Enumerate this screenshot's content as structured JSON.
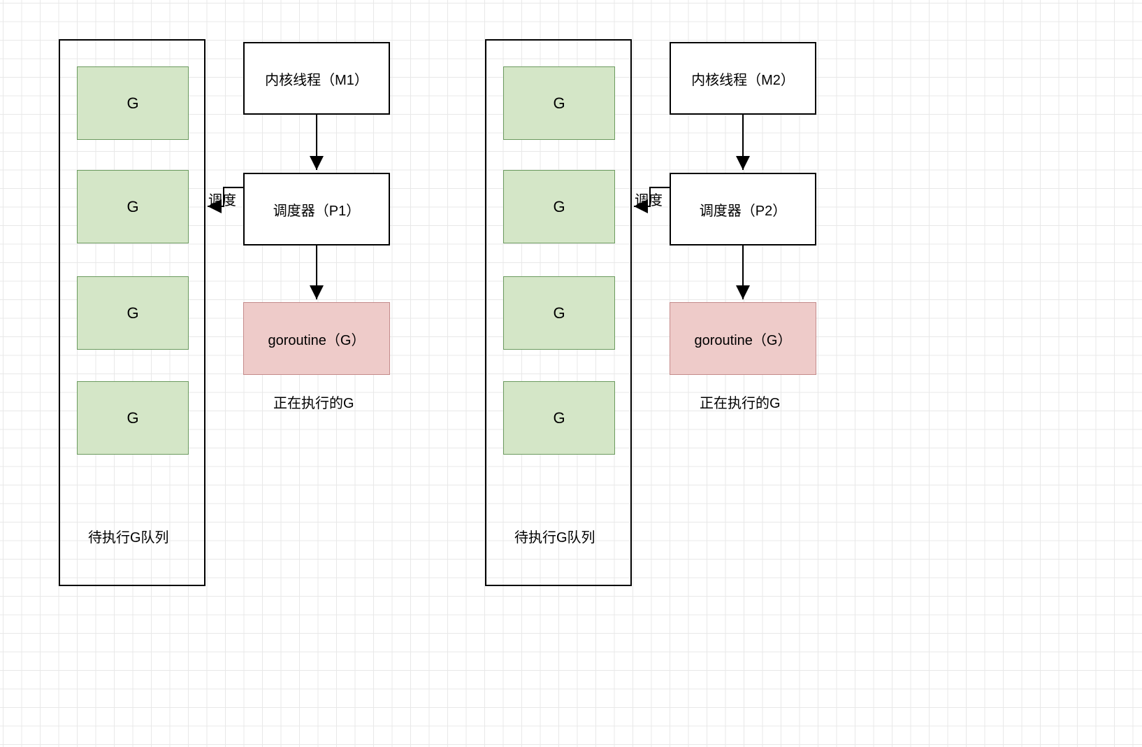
{
  "chart_data": {
    "type": "diagram",
    "groups": [
      {
        "queue": {
          "label": "待执行G队列",
          "items": [
            "G",
            "G",
            "G",
            "G"
          ]
        },
        "kernel_thread": "内核线程（M1）",
        "scheduler": "调度器（P1）",
        "goroutine": "goroutine（G）",
        "running_label": "正在执行的G",
        "schedule_edge_label": "调度"
      },
      {
        "queue": {
          "label": "待执行G队列",
          "items": [
            "G",
            "G",
            "G",
            "G"
          ]
        },
        "kernel_thread": "内核线程（M2）",
        "scheduler": "调度器（P2）",
        "goroutine": "goroutine（G）",
        "running_label": "正在执行的G",
        "schedule_edge_label": "调度"
      }
    ]
  }
}
